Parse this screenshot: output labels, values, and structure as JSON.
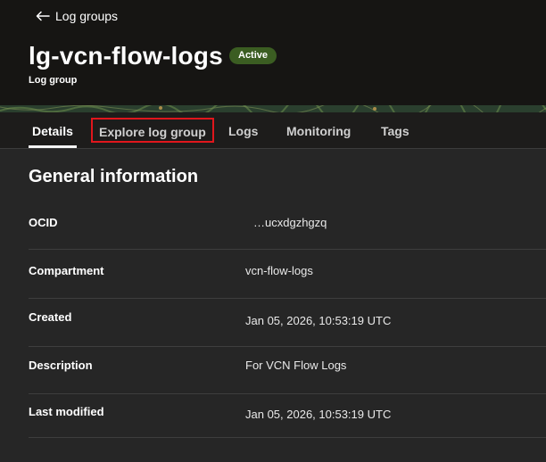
{
  "header": {
    "back_label": "Log groups",
    "title": "lg-vcn-flow-logs",
    "status_badge": "Active",
    "subtitle": "Log group"
  },
  "tabs": [
    {
      "label": "Details",
      "active": true
    },
    {
      "label": "Explore log group",
      "highlighted": true
    },
    {
      "label": "Logs"
    },
    {
      "label": "Monitoring"
    },
    {
      "label": "Tags"
    }
  ],
  "general_information": {
    "title": "General information",
    "rows": [
      {
        "label": "OCID",
        "value": "…ucxdgzhgzq"
      },
      {
        "label": "Compartment",
        "value": "vcn-flow-logs"
      },
      {
        "label": "Created",
        "value": "Jan 05, 2026, 10:53:19 UTC"
      },
      {
        "label": "Description",
        "value": "For VCN Flow Logs"
      },
      {
        "label": "Last modified",
        "value": "Jan 05, 2026, 10:53:19 UTC"
      }
    ]
  },
  "colors": {
    "header_bg": "#161513",
    "badge_bg": "#3b5d22",
    "highlight_border": "#e0161c",
    "content_bg": "#262626"
  },
  "icons": {
    "back": "arrow-left-icon"
  }
}
